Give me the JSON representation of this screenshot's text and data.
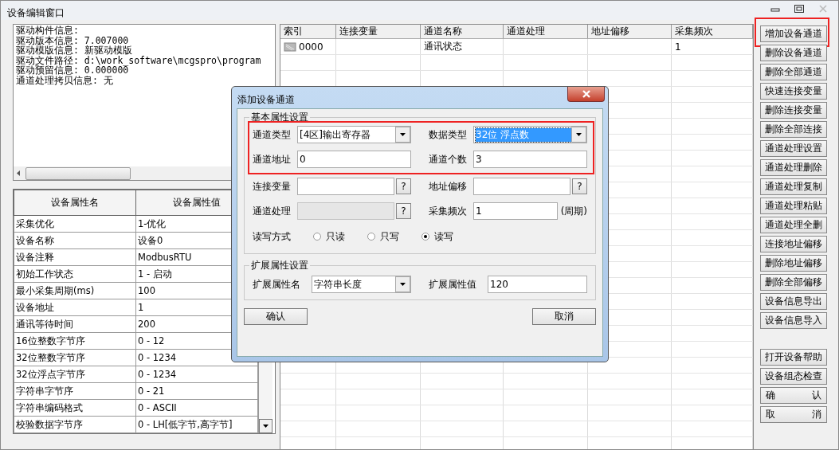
{
  "window": {
    "title": "设备编辑窗口"
  },
  "driver_info": {
    "lines": [
      "驱动构件信息:",
      "驱动版本信息: 7.007000",
      "驱动模版信息: 新驱动模版",
      "驱动文件路径: d:\\work_software\\mcgspro\\program",
      "驱动预留信息: 0.000000",
      "通道处理拷贝信息: 无"
    ]
  },
  "device_properties": {
    "columns": [
      "设备属性名",
      "设备属性值"
    ],
    "rows": [
      [
        "采集优化",
        "1-优化"
      ],
      [
        "设备名称",
        "设备0"
      ],
      [
        "设备注释",
        "ModbusRTU"
      ],
      [
        "初始工作状态",
        "1 - 启动"
      ],
      [
        "最小采集周期(ms)",
        "100"
      ],
      [
        "设备地址",
        "1"
      ],
      [
        "通讯等待时间",
        "200"
      ],
      [
        "16位整数字节序",
        "0 - 12"
      ],
      [
        "32位整数字节序",
        "0 - 1234"
      ],
      [
        "32位浮点字节序",
        "0 - 1234"
      ],
      [
        "字符串字节序",
        "0 - 21"
      ],
      [
        "字符串编码格式",
        "0 - ASCII"
      ],
      [
        "校验数据字节序",
        "0 - LH[低字节,高字节]"
      ]
    ]
  },
  "channel_table": {
    "columns": [
      "索引",
      "连接变量",
      "通道名称",
      "通道处理",
      "地址偏移",
      "采集频次"
    ],
    "rows": [
      {
        "index": "0000",
        "channel_name": "通讯状态",
        "frequency": "1"
      }
    ]
  },
  "buttons": [
    {
      "label": "增加设备通道",
      "kind": "normal",
      "highlighted": true
    },
    {
      "label": "删除设备通道",
      "kind": "normal",
      "highlighted": false
    },
    {
      "label": "删除全部通道",
      "kind": "normal",
      "highlighted": false
    },
    {
      "label": "快速连接变量",
      "kind": "normal",
      "highlighted": false
    },
    {
      "label": "删除连接变量",
      "kind": "normal",
      "highlighted": false
    },
    {
      "label": "删除全部连接",
      "kind": "normal",
      "highlighted": false
    },
    {
      "label": "通道处理设置",
      "kind": "normal",
      "highlighted": false
    },
    {
      "label": "通道处理删除",
      "kind": "normal",
      "highlighted": false
    },
    {
      "label": "通道处理复制",
      "kind": "normal",
      "highlighted": false
    },
    {
      "label": "通道处理粘贴",
      "kind": "normal",
      "highlighted": false
    },
    {
      "label": "通道处理全删",
      "kind": "normal",
      "highlighted": false
    },
    {
      "label": "连接地址偏移",
      "kind": "normal",
      "highlighted": false
    },
    {
      "label": "删除地址偏移",
      "kind": "normal",
      "highlighted": false
    },
    {
      "label": "删除全部偏移",
      "kind": "normal",
      "highlighted": false
    },
    {
      "label": "设备信息导出",
      "kind": "normal",
      "highlighted": false
    },
    {
      "label": "设备信息导入",
      "kind": "normal",
      "highlighted": false
    },
    {
      "label": "打开设备帮助",
      "kind": "gap",
      "highlighted": false
    },
    {
      "label": "设备组态检查",
      "kind": "normal",
      "highlighted": false
    },
    {
      "label": "确认",
      "kind": "spread",
      "highlighted": false
    },
    {
      "label": "取消",
      "kind": "spread",
      "highlighted": false
    }
  ],
  "dialog": {
    "title": "添加设备通道",
    "basic": {
      "legend": "基本属性设置",
      "sections": [
        {
          "highlighted": true,
          "fields": [
            {
              "label": "通道类型",
              "kind": "combo",
              "value": "[4区]输出寄存器",
              "focused": false,
              "disabled": false
            },
            {
              "label": "数据类型",
              "kind": "combo",
              "value": "32位 浮点数",
              "focused": true,
              "disabled": false
            },
            {
              "label": "通道地址",
              "kind": "text",
              "value": "0",
              "focused": false,
              "disabled": false
            },
            {
              "label": "通道个数",
              "kind": "text",
              "value": "3",
              "focused": false,
              "disabled": false
            }
          ]
        },
        {
          "highlighted": false,
          "fields": [
            {
              "label": "连接变量",
              "kind": "picker",
              "button": "?",
              "focused": false,
              "disabled": false
            },
            {
              "label": "地址偏移",
              "kind": "picker",
              "button": "?",
              "focused": false,
              "disabled": false
            },
            {
              "label": "通道处理",
              "kind": "picker",
              "button": "?",
              "focused": false,
              "disabled": true
            },
            {
              "label": "采集频次",
              "kind": "text",
              "value": "1",
              "suffix": "(周期)",
              "focused": false,
              "disabled": false
            }
          ]
        }
      ],
      "access": {
        "label": "读写方式",
        "options": [
          {
            "label": "只读",
            "selected": false
          },
          {
            "label": "只写",
            "selected": false
          },
          {
            "label": "读写",
            "selected": true
          }
        ]
      }
    },
    "extended": {
      "legend": "扩展属性设置",
      "fields": [
        {
          "label": "扩展属性名",
          "kind": "combo",
          "value": "字符串长度",
          "focused": false,
          "disabled": false
        },
        {
          "label": "扩展属性值",
          "kind": "text",
          "value": "120",
          "focused": false,
          "disabled": false
        }
      ]
    },
    "buttons": [
      {
        "label": "确认"
      },
      {
        "label": "取消"
      }
    ]
  }
}
